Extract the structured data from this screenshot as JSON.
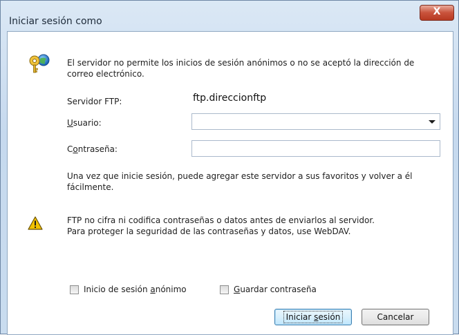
{
  "window": {
    "title": "Iniciar sesión como",
    "close_glyph": "X"
  },
  "message": {
    "anon_not_allowed": "El servidor no permite los inicios de sesión anónimos o no se aceptó la dirección de correo electrónico.",
    "favorites_hint": "Una vez que inicie sesión, puede agregar este servidor a sus favoritos y volver a él fácilmente.",
    "warning_line1": "FTP no cifra ni codifica contraseñas o datos antes de enviarlos al servidor.",
    "warning_line2": "Para proteger la seguridad de las contraseñas y datos, use WebDAV."
  },
  "form": {
    "server_label": "Servidor FTP:",
    "server_value": "ftp.direccionftp",
    "user_label_access": "U",
    "user_label_rest": "suario:",
    "user_value": "",
    "password_label_prefix": "C",
    "password_label_access": "o",
    "password_label_rest": "ntraseña:",
    "password_value": ""
  },
  "options": {
    "anonymous_prefix": "Inicio de sesión ",
    "anonymous_access": "a",
    "anonymous_rest": "nónimo",
    "anonymous_checked": false,
    "save_access": "G",
    "save_rest": "uardar contraseña",
    "save_checked": false
  },
  "buttons": {
    "login_prefix": "Iniciar ",
    "login_access": "s",
    "login_rest": "esión",
    "cancel": "Cancelar"
  },
  "icons": {
    "key": "key-globe-icon",
    "warning": "warning-icon",
    "dropdown": "chevron-down-icon"
  },
  "colors": {
    "accent_border": "#3c7fb1",
    "close_button": "#c9523b",
    "warning_yellow": "#f2c200"
  }
}
